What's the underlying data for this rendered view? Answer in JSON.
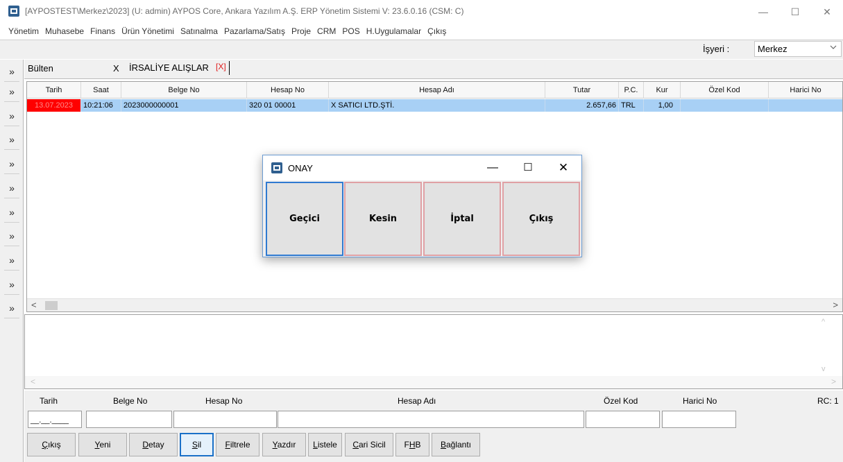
{
  "window": {
    "title": "[AYPOSTEST\\Merkez\\2023] (U: admin) AYPOS Core, Ankara Yazılım A.Ş. ERP Yönetim Sistemi V: 23.6.0.16 (CSM: C)",
    "minimize": "—",
    "maximize": "☐",
    "close": "✕"
  },
  "menu": [
    "Yönetim",
    "Muhasebe",
    "Finans",
    "Ürün Yönetimi",
    "Satınalma",
    "Pazarlama/Satış",
    "Proje",
    "CRM",
    "POS",
    "H.Uygulamalar",
    "Çıkış"
  ],
  "workplace": {
    "label": "İşyeri :",
    "value": "Merkez"
  },
  "side_strip": {
    "button_label": "»"
  },
  "tabs": [
    {
      "label": "Bülten",
      "close": "X"
    },
    {
      "label": "İRSALİYE ALIŞLAR",
      "close": "[X]"
    }
  ],
  "grid": {
    "columns": [
      "Tarih",
      "Saat",
      "Belge No",
      "Hesap No",
      "Hesap Adı",
      "Tutar",
      "P.C.",
      "Kur",
      "Özel Kod",
      "Harici No"
    ],
    "rows": [
      {
        "tarih": "13.07.2023",
        "saat": "10:21:06",
        "belge_no": "2023000000001",
        "hesap_no": "320 01 00001",
        "hesap_adi": "X SATICI LTD.ŞTİ.",
        "tutar": "2.657,66",
        "pc": "TRL",
        "kur": "1,00",
        "ozel_kod": "",
        "harici_no": ""
      }
    ],
    "scroll_left": "<",
    "scroll_right": ">"
  },
  "memo": {
    "up": "^",
    "down": "v",
    "left": "<",
    "right": ">"
  },
  "filter": {
    "labels": {
      "tarih": "Tarih",
      "belge_no": "Belge No",
      "hesap_no": "Hesap No",
      "hesap_adi": "Hesap Adı",
      "ozel_kod": "Özel Kod",
      "harici_no": "Harici No",
      "rc": "RC: 1"
    },
    "tarih_value": "__.__.____"
  },
  "buttons": [
    "Çıkış",
    "Yeni",
    "Detay",
    "Sil",
    "Filtrele",
    "Yazdır",
    "Listele",
    "Cari Sicil",
    "FHB",
    "Bağlantı"
  ],
  "button_mnemonics": [
    "Ç",
    "Y",
    "D",
    "S",
    "F",
    "Y",
    "L",
    "C",
    "H",
    "B"
  ],
  "dialog": {
    "title": "ONAY",
    "minimize": "—",
    "maximize": "☐",
    "close": "✕",
    "options": [
      "Geçici",
      "Kesin",
      "İptal",
      "Çıkış"
    ]
  },
  "colors": {
    "selected_row": "#a8d0f5",
    "date_cell": "#ff0000",
    "dialog_focus": "#2f7ad1"
  }
}
